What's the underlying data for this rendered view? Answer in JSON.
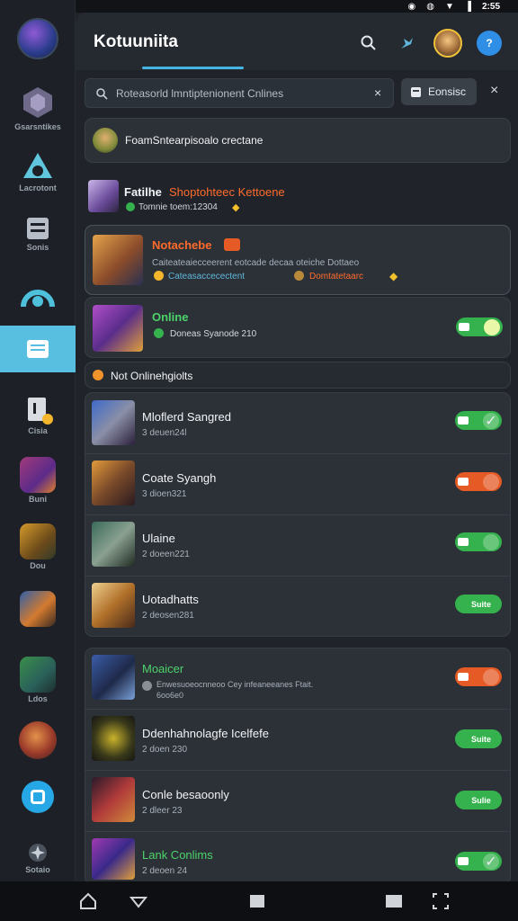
{
  "status_bar": {
    "time": "2:55"
  },
  "app": {
    "title": "Kotuuniita"
  },
  "search": {
    "query": "Roteasorld lmntiptenionent Cnlines",
    "clear": "×",
    "filter_label": "Eonsisc",
    "close": "×"
  },
  "sidebar": [
    {
      "label": "",
      "name": "sidebar-profile-avatar"
    },
    {
      "label": "Gsarsntikes",
      "name": "sidebar-item-games"
    },
    {
      "label": "Lacrotont",
      "name": "sidebar-item-leaderboard"
    },
    {
      "label": "Sonis",
      "name": "sidebar-item-store"
    },
    {
      "label": "",
      "name": "sidebar-item-discover"
    },
    {
      "label": "",
      "name": "sidebar-item-messages"
    },
    {
      "label": "Cisia",
      "name": "sidebar-item-inventory"
    },
    {
      "label": "Buni",
      "name": "sidebar-item-squad"
    },
    {
      "label": "Dou",
      "name": "sidebar-item-friends"
    },
    {
      "label": "",
      "name": "sidebar-item-hero"
    },
    {
      "label": "Ldos",
      "name": "sidebar-item-tools"
    },
    {
      "label": "",
      "name": "sidebar-item-guild"
    },
    {
      "label": "",
      "name": "sidebar-item-chat"
    },
    {
      "label": "Sotaio",
      "name": "sidebar-item-settings"
    }
  ],
  "banner": {
    "text": "FoamSntearpisoalo crectane"
  },
  "featured": {
    "title": "Fatilhe",
    "subtitle": "Shoptohteec Kettoene",
    "meta": "Tomnie toem:12304"
  },
  "notification": {
    "title": "Notachebe",
    "line1": "Caiteateaiecceerent eotcade decaa oteiche Dottaeo",
    "line2": "Cateasaccecectent",
    "line3": "Domtatetaarc"
  },
  "online_card": {
    "title": "Online",
    "meta": "Doneas Syanode 210"
  },
  "section": {
    "label": "Not Onlinehgiolts"
  },
  "friends": [
    {
      "name": "Mloflerd Sangred",
      "meta": "3 deuen24l",
      "status": "green"
    },
    {
      "name": "Coate Syangh",
      "meta": "3 dioen321",
      "status": "orange"
    },
    {
      "name": "Ulaine",
      "meta": "2 doeen221",
      "status": "green"
    },
    {
      "name": "Uotadhatts",
      "meta": "2 deosen281",
      "status": "green-label",
      "toggle_label": "Suite"
    }
  ],
  "friends2": [
    {
      "name": "Moaicer",
      "meta": "Enwesuoeocnneoo Cey infeaneeanes Ftait.",
      "meta2": "6oo6e0",
      "status": "orange"
    },
    {
      "name": "Ddenhahnolagfe Icelfefe",
      "meta": "2 doen 230",
      "status": "green-label",
      "toggle_label": "Suite"
    },
    {
      "name": "Conle besaoonly",
      "meta": "2 dleer 23",
      "status": "green-label",
      "toggle_label": "Sulie"
    },
    {
      "name": "Lank Conlims",
      "meta": "2 deoen 24",
      "status": "green"
    }
  ],
  "colors": {
    "accent": "#47b5e4",
    "online": "#35b24d",
    "away": "#e55a25",
    "highlight": "#ff6b2b"
  }
}
